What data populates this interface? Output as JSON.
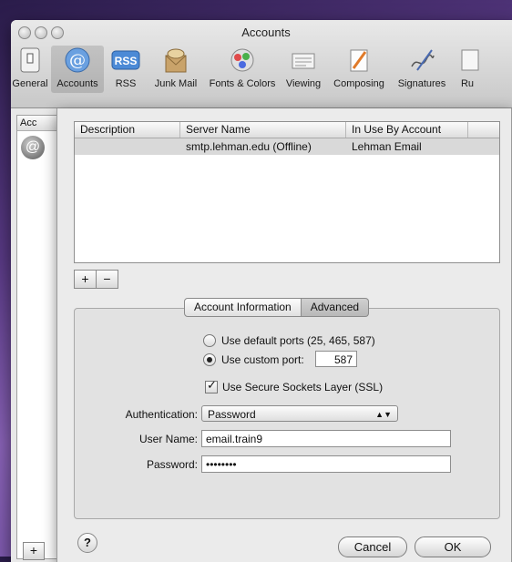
{
  "window": {
    "title": "Accounts"
  },
  "toolbar": {
    "items": [
      {
        "label": "General"
      },
      {
        "label": "Accounts"
      },
      {
        "label": "RSS"
      },
      {
        "label": "Junk Mail"
      },
      {
        "label": "Fonts & Colors"
      },
      {
        "label": "Viewing"
      },
      {
        "label": "Composing"
      },
      {
        "label": "Signatures"
      },
      {
        "label": "Ru"
      }
    ],
    "rss_badge": "RSS",
    "accounts_glyph": "@"
  },
  "accounts_list": {
    "header": "Acc",
    "avatar_glyph": "@"
  },
  "sheet": {
    "table": {
      "columns": [
        "Description",
        "Server Name",
        "In Use By Account"
      ],
      "rows": [
        {
          "description": "",
          "server_name": "smtp.lehman.edu (Offline)",
          "in_use_by": "Lehman Email"
        }
      ]
    },
    "add_symbol": "+",
    "remove_symbol": "−",
    "tabs": [
      "Account Information",
      "Advanced"
    ],
    "ports": {
      "default_label": "Use default ports (25, 465, 587)",
      "custom_label": "Use custom port:",
      "custom_value": "587",
      "selected": "custom"
    },
    "ssl": {
      "label": "Use Secure Sockets Layer (SSL)",
      "checked": true
    },
    "authentication": {
      "label": "Authentication:",
      "value": "Password",
      "arrows": "▲▼"
    },
    "username": {
      "label": "User Name:",
      "value": "email.train9"
    },
    "password": {
      "label": "Password:",
      "value": "••••••••"
    },
    "help_label": "?",
    "cancel_label": "Cancel",
    "ok_label": "OK"
  }
}
